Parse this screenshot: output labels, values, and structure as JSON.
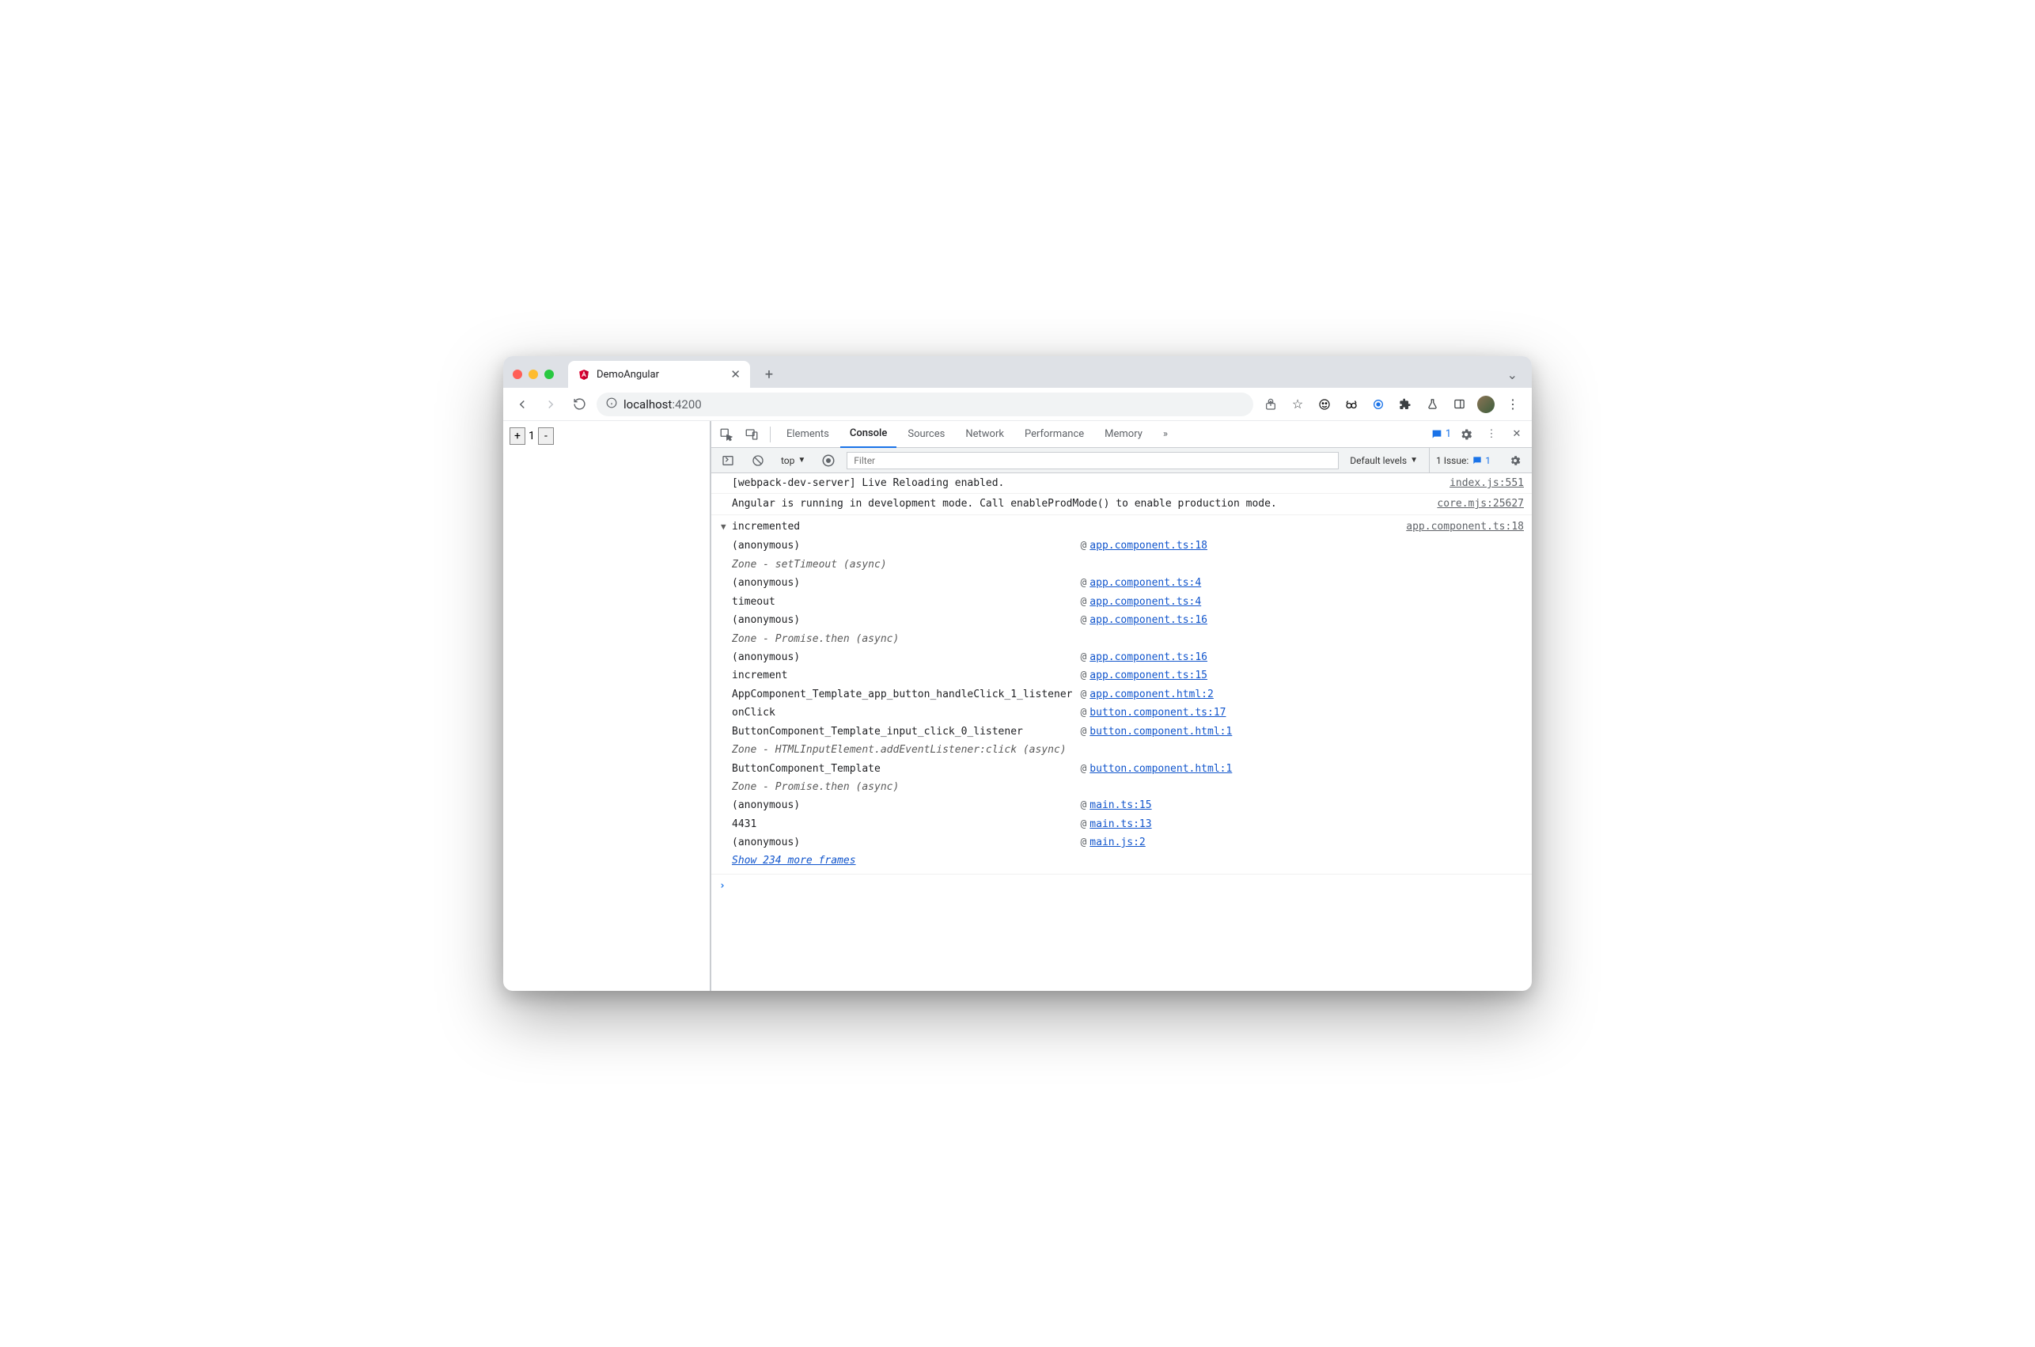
{
  "window": {
    "tab_title": "DemoAngular"
  },
  "omnibox": {
    "host": "localhost",
    "port": ":4200"
  },
  "page": {
    "counter_value": "1",
    "plus_label": "+",
    "minus_label": "-"
  },
  "devtools": {
    "tabs": [
      "Elements",
      "Console",
      "Sources",
      "Network",
      "Performance",
      "Memory"
    ],
    "active_tab": "Console",
    "messages_badge": "1",
    "toolbar": {
      "context": "top",
      "filter_placeholder": "Filter",
      "levels": "Default levels",
      "issues_label": "1 Issue:",
      "issues_count": "1"
    },
    "logs": [
      {
        "msg": "[webpack-dev-server] Live Reloading enabled.",
        "src": "index.js:551"
      },
      {
        "msg": "Angular is running in development mode. Call enableProdMode() to enable production mode.",
        "src": "core.mjs:25627"
      }
    ],
    "trace": {
      "title": "incremented",
      "src": "app.component.ts:18",
      "frames": [
        {
          "fn": "(anonymous)",
          "link": "app.component.ts:18"
        },
        {
          "zone": "Zone - setTimeout (async)"
        },
        {
          "fn": "(anonymous)",
          "link": "app.component.ts:4"
        },
        {
          "fn": "timeout",
          "link": "app.component.ts:4"
        },
        {
          "fn": "(anonymous)",
          "link": "app.component.ts:16"
        },
        {
          "zone": "Zone - Promise.then (async)"
        },
        {
          "fn": "(anonymous)",
          "link": "app.component.ts:16"
        },
        {
          "fn": "increment",
          "link": "app.component.ts:15"
        },
        {
          "fn": "AppComponent_Template_app_button_handleClick_1_listener",
          "link": "app.component.html:2"
        },
        {
          "fn": "onClick",
          "link": "button.component.ts:17"
        },
        {
          "fn": "ButtonComponent_Template_input_click_0_listener",
          "link": "button.component.html:1"
        },
        {
          "zone": "Zone - HTMLInputElement.addEventListener:click (async)"
        },
        {
          "fn": "ButtonComponent_Template",
          "link": "button.component.html:1"
        },
        {
          "zone": "Zone - Promise.then (async)"
        },
        {
          "fn": "(anonymous)",
          "link": "main.ts:15"
        },
        {
          "fn": "4431",
          "link": "main.ts:13"
        },
        {
          "fn": "(anonymous)",
          "link": "main.js:2"
        }
      ],
      "more": "Show 234 more frames"
    },
    "prompt": "›"
  }
}
